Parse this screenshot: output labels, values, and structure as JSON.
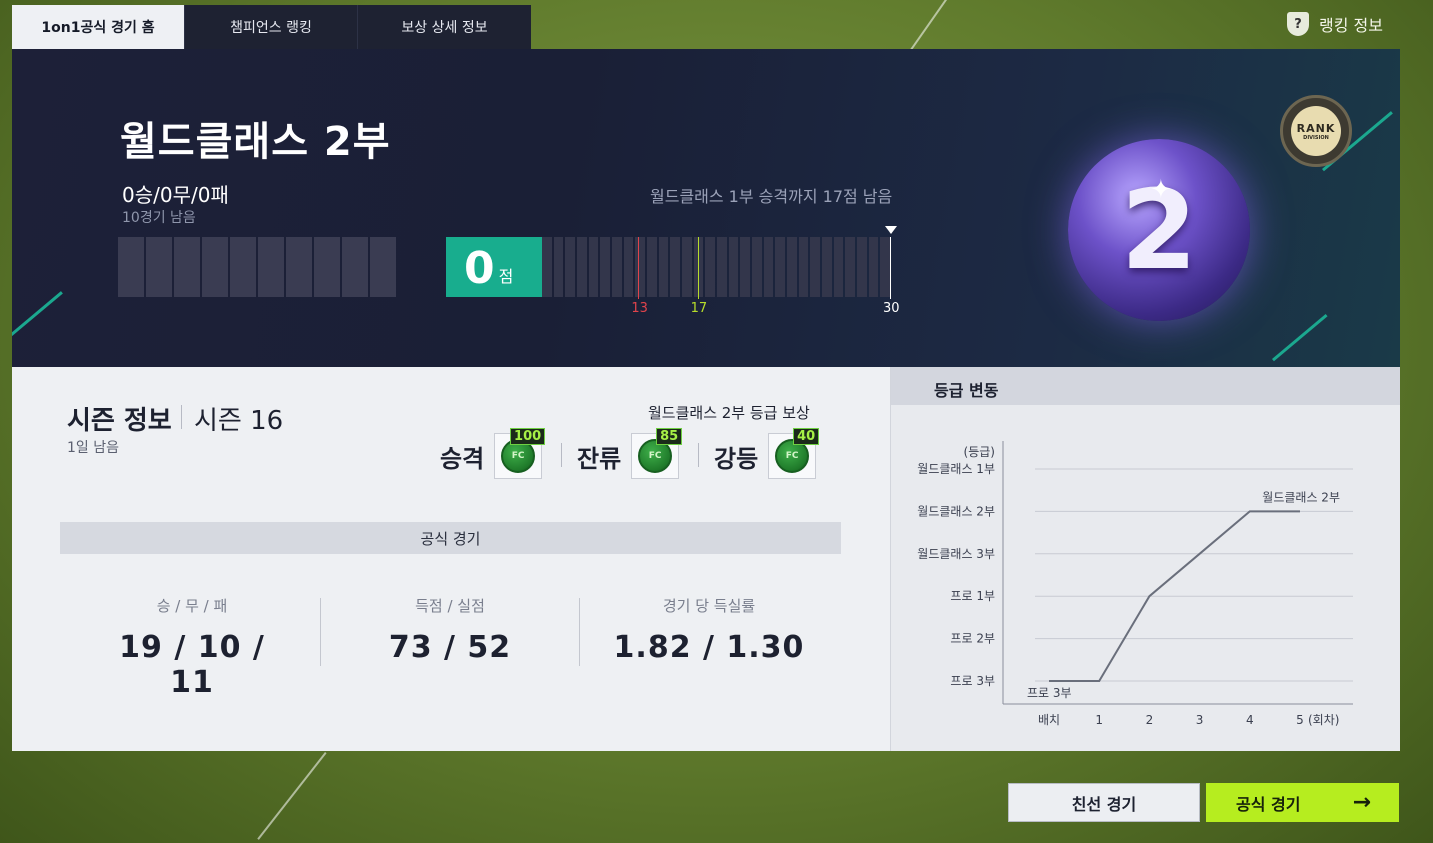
{
  "tabs": [
    "1on1공식 경기 홈",
    "챔피언스 랭킹",
    "보상 상세 정보"
  ],
  "rank_info_label": "랭킹 정보",
  "division": {
    "title": "월드클래스 2부",
    "record": "0승/0무/0패",
    "games_remaining": "10경기 남음",
    "promotion_text": "월드클래스 1부 승격까지 17점 남음",
    "points": "0",
    "points_unit": "점",
    "max_points": 30,
    "current_points": 0,
    "markers": [
      {
        "label": "13",
        "value": 13,
        "color": "#e0434b"
      },
      {
        "label": "17",
        "value": 17,
        "color": "#b6dc2a"
      },
      {
        "label": "30",
        "value": 30,
        "color": "#ffffff"
      }
    ],
    "badge_text": "RANK",
    "badge_sub": "DIVISION",
    "orb_number": "2"
  },
  "season": {
    "title": "시즌 정보",
    "number": "시즌 16",
    "remaining": "1일 남음",
    "reward_title": "월드클래스 2부 등급 보상",
    "rewards": [
      {
        "label": "승격",
        "count": "100",
        "coin": "FC"
      },
      {
        "label": "잔류",
        "count": "85",
        "coin": "FC"
      },
      {
        "label": "강등",
        "count": "40",
        "coin": "FC"
      }
    ],
    "official_label": "공식 경기",
    "stats": [
      {
        "header": "승 / 무 / 패",
        "value": "19 / 10 / 11"
      },
      {
        "header": "득점 / 실점",
        "value": "73 / 52"
      },
      {
        "header": "경기 당 득실률",
        "value": "1.82 / 1.30"
      }
    ]
  },
  "grade_change": {
    "title": "등급 변동",
    "y_caption": "(등급)",
    "x_unit": "(회차)",
    "chart_data": {
      "type": "line",
      "x": [
        "배치",
        "1",
        "2",
        "3",
        "4",
        "5"
      ],
      "y_categories": [
        "월드클래스 1부",
        "월드클래스 2부",
        "월드클래스 3부",
        "프로 1부",
        "프로 2부",
        "프로 3부"
      ],
      "series": [
        {
          "values": [
            "프로 3부",
            "프로 3부",
            "프로 1부",
            "월드클래스 3부",
            "월드클래스 2부",
            "월드클래스 2부"
          ],
          "x_positions": [
            0,
            1,
            2,
            3,
            4,
            5
          ]
        }
      ],
      "point_labels": [
        {
          "x": "배치",
          "text": "프로 3부"
        },
        {
          "x": "5",
          "text": "월드클래스 2부"
        }
      ]
    }
  },
  "buttons": {
    "friendly": "친선 경기",
    "official": "공식 경기",
    "official_arrow": "→"
  },
  "colors": {
    "accent_green": "#b6ed1f",
    "teal": "#18ad8e",
    "hero_bg": "#1d2038"
  },
  "icons": [
    "shield-question-icon",
    "rank-badge-icon",
    "fc-coin-icon",
    "arrow-right-icon"
  ]
}
